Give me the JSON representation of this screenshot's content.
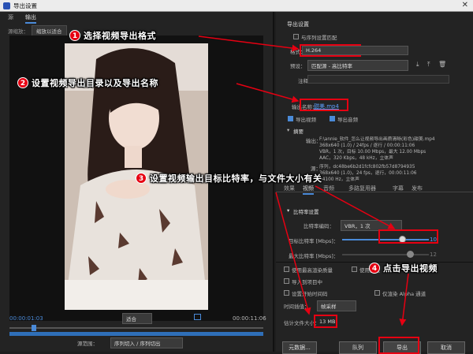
{
  "window": {
    "title": "导出设置",
    "close": "✕"
  },
  "left": {
    "tabs": [
      "源",
      "输出"
    ],
    "source_scale_label": "源缩放：",
    "source_scale_value": "缩放以适合",
    "time_start": "00:00:01:03",
    "time_end": "00:00:11:06",
    "fit": "适合",
    "source_range_label": "源范围：",
    "source_range_value": "序列切入 / 序列切出"
  },
  "right": {
    "section": "导出设置",
    "match_seq": "与序列设置匹配",
    "format_label": "格式：",
    "format_value": "H.264",
    "preset_label": "预设：",
    "preset_value": "匹配源 - 高比特率",
    "comment_label": "注释：",
    "output_name_label": "输出名称：",
    "output_name_value": "甜美.mp4",
    "export_video": "导出视频",
    "export_audio": "导出音频",
    "summary_title": "摘要",
    "summary_output_label": "输出：",
    "summary_output": "F:\\annie_软件_怎么让视频导出画质清晰(彩色)甜美.mp4\n368x640 (1.0) / 24fps / 逐行 / 00:00:11:06\nVBR，1 次，目标 10.00 Mbps，最大 12.00 Mbps\nAAC，320 Kbps，48 kHz，立体声",
    "summary_source_label": "源：",
    "summary_source": "序列，dc48be6b2d1fcfc802fb57d8794935\n368x640 (1.0)，24 fps，逐行，00:00:11:06\n44100 Hz，立体声",
    "tabs2": [
      "效果",
      "视频",
      "音频",
      "多路复用器",
      "字幕",
      "发布"
    ],
    "bitrate_title": "比特率设置",
    "encode_label": "比特率编码：",
    "encode_value": "VBR，1 次",
    "target_label": "目标比特率 [Mbps]：",
    "target_value": "10",
    "max_label": "最大比特率 [Mbps]：",
    "max_value": "12",
    "max_quality": "使用最高渲染质量",
    "preview": "使用预览",
    "import_project": "导入到项目中",
    "set_start": "设置开始时间码",
    "alpha": "仅渲染 Alpha 通道",
    "interp_label": "时间插值：",
    "interp_value": "帧采样",
    "filesize_label": "估计文件大小：",
    "filesize_value": "13 MB",
    "btn_meta": "元数据...",
    "btn_queue": "队列",
    "btn_export": "导出",
    "btn_cancel": "取消"
  },
  "annotations": {
    "n1": "1",
    "a1": "选择视频导出格式",
    "n2": "2",
    "a2": "设置视频导出目录以及导出名称",
    "n3": "3",
    "a3": "设置视频输出目标比特率，与文件大小有关",
    "n4": "4",
    "a4": "点击导出视频"
  }
}
